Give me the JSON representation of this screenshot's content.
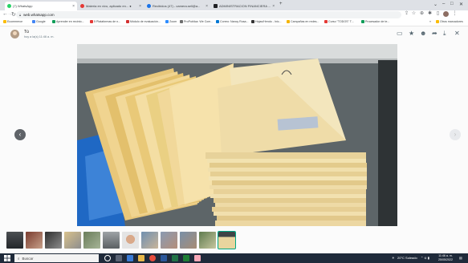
{
  "browser": {
    "tabs": [
      {
        "title": "(7) WhatsApp",
        "fav_color": "#25d366",
        "active": true
      },
      {
        "title": "Materia en vivo, aplicado en... ●",
        "fav_color": "#e53935",
        "active": false
      },
      {
        "title": "Recibidos (47) - camera.sell@a...",
        "fav_color": "#1a73e8",
        "active": false
      },
      {
        "title": "ADMINISTRACION FINANCIERA ...",
        "fav_color": "#202124",
        "active": false
      }
    ],
    "new_tab": "+",
    "window_controls": [
      "⌄",
      "–",
      "□",
      "✕"
    ]
  },
  "toolbar": {
    "back": "←",
    "forward": "→",
    "reload": "↻",
    "url": "web.whatsapp.com",
    "icons": [
      "share-icon",
      "star-icon",
      "extension-icon",
      "puzzle-icon",
      "sidebar-icon",
      "profile-icon",
      "menu-icon"
    ]
  },
  "bookmarks": [
    {
      "label": "Ecommerce",
      "color": "#fbbc04"
    },
    {
      "label": "Google",
      "color": "#4285f4"
    },
    {
      "label": "Aprender en recinto...",
      "color": "#0f9d58"
    },
    {
      "label": "5 Plataformas de n...",
      "color": "#e53935"
    },
    {
      "label": "Módulo de evaluación...",
      "color": "#d32f2f"
    },
    {
      "label": "Zoom",
      "color": "#2d8cff"
    },
    {
      "label": "ProPublica: We Com...",
      "color": "#6d6d6d"
    },
    {
      "label": "Correo: Nancy Rosa...",
      "color": "#0078d4"
    },
    {
      "label": "Hojas/Hendo - Inic...",
      "color": "#333333"
    },
    {
      "label": "Campañas en redes...",
      "color": "#f4b400"
    },
    {
      "label": "Curso \"TODOS\" T...",
      "color": "#e53935"
    },
    {
      "label": "Procesador de te...",
      "color": "#0f9d58"
    }
  ],
  "bookmarks_more": "»",
  "bookmarks_folder": "Otros marcadores",
  "viewer": {
    "sender": "Tú",
    "time": "hoy a la(s) 11:46 a. m.",
    "actions": [
      "chat-icon",
      "star-icon",
      "emoji-icon",
      "forward-icon",
      "download-icon",
      "close-icon"
    ],
    "prev": "‹",
    "next": "›"
  },
  "thumbnails": [
    {
      "kind": "photo-dark"
    },
    {
      "kind": "photo-red"
    },
    {
      "kind": "photo-group"
    },
    {
      "kind": "photo-papers"
    },
    {
      "kind": "photo-green"
    },
    {
      "kind": "photo-gray"
    },
    {
      "kind": "photo-face"
    },
    {
      "kind": "photo-group"
    },
    {
      "kind": "photo-group"
    },
    {
      "kind": "photo-group"
    },
    {
      "kind": "photo-green"
    },
    {
      "kind": "photo-papers",
      "selected": true
    }
  ],
  "taskbar": {
    "search_placeholder": "Buscar",
    "weather": "20°C Soleado",
    "tray_icons": "⌃ ⎀ ▮",
    "clock_time": "11:46 a. m.",
    "clock_date": "25/05/2022"
  }
}
